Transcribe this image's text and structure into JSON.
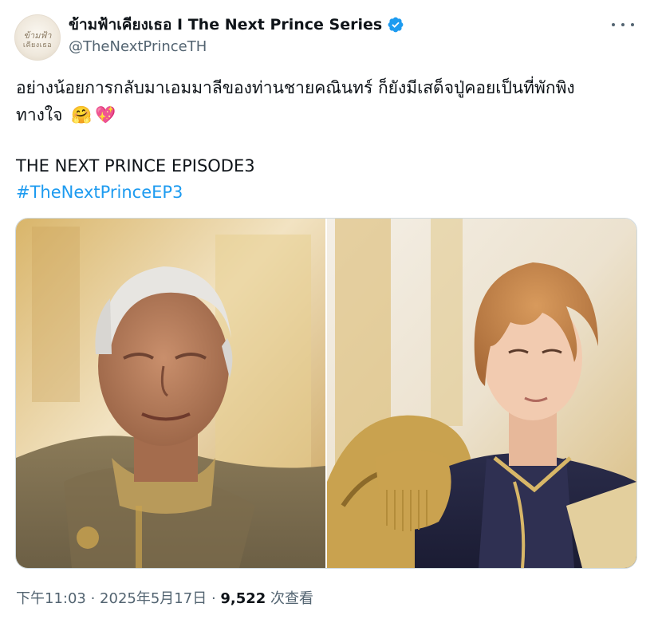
{
  "author": {
    "display_name": "ข้ามฟ้าเคียงเธอ I The Next Prince Series",
    "handle": "@TheNextPrinceTH",
    "avatar_logo_line1": "ข้ามฟ้า",
    "avatar_logo_line2": "เคียงเธอ",
    "verified": true
  },
  "tweet": {
    "text_line1": "อย่างน้อยการกลับมาเอมมาลีของท่านชายคณินทร์ ก็ยังมีเสด็จปู่คอยเป็นที่พักพิง",
    "text_line2": "ทางใจ",
    "emojis": [
      "🤗",
      "💖"
    ],
    "title": "THE NEXT PRINCE EPISODE3",
    "hashtag": "#TheNextPrinceEP3"
  },
  "meta": {
    "time": "下午11:03",
    "sep1": " · ",
    "date": "2025年5月17日",
    "sep2": " · ",
    "views_count": "9,522",
    "views_label": " 次查看"
  },
  "colors": {
    "link": "#1d9bf0",
    "verified": "#1d9bf0",
    "secondary_text": "#536471",
    "primary_text": "#0f1419"
  }
}
